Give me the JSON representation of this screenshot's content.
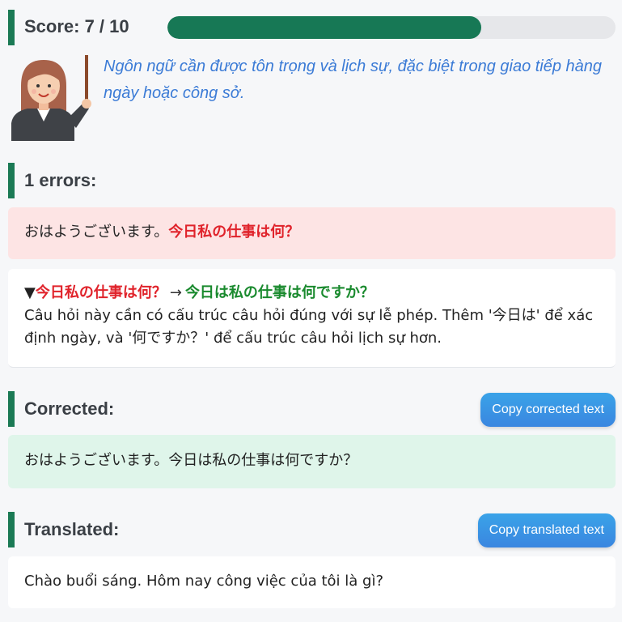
{
  "score": {
    "label": "Score: 7 / 10",
    "fraction": 0.7
  },
  "teacher": {
    "icon": "teacher-icon",
    "quote": "Ngôn ngữ cần được tôn trọng và lịch sự, đặc biệt trong giao tiếp hàng ngày hoặc công sở."
  },
  "errors": {
    "heading": "1 errors:",
    "original_prefix": "おはようございます。",
    "original_error": "今日私の仕事は何？",
    "detail": {
      "toggle": "▼",
      "wrong": "今日私の仕事は何？",
      "arrow": "→",
      "right": "今日は私の仕事は何ですか？",
      "explanation": "Câu hỏi này cần có cấu trúc câu hỏi đúng với sự lễ phép. Thêm '今日は' để xác định ngày, và '何ですか？' để cấu trúc câu hỏi lịch sự hơn."
    }
  },
  "corrected": {
    "heading": "Corrected:",
    "copy_label": "Copy corrected text",
    "text": "おはようございます。今日は私の仕事は何ですか？"
  },
  "translated": {
    "heading": "Translated:",
    "copy_label": "Copy translated text",
    "text": "Chào buổi sáng. Hôm nay công việc của tôi là gì?"
  },
  "colors": {
    "accent": "#1b7a55",
    "error": "#e0232b",
    "fix": "#1a8a2e",
    "quote": "#3b7bd6",
    "button": "#3a92e4"
  }
}
